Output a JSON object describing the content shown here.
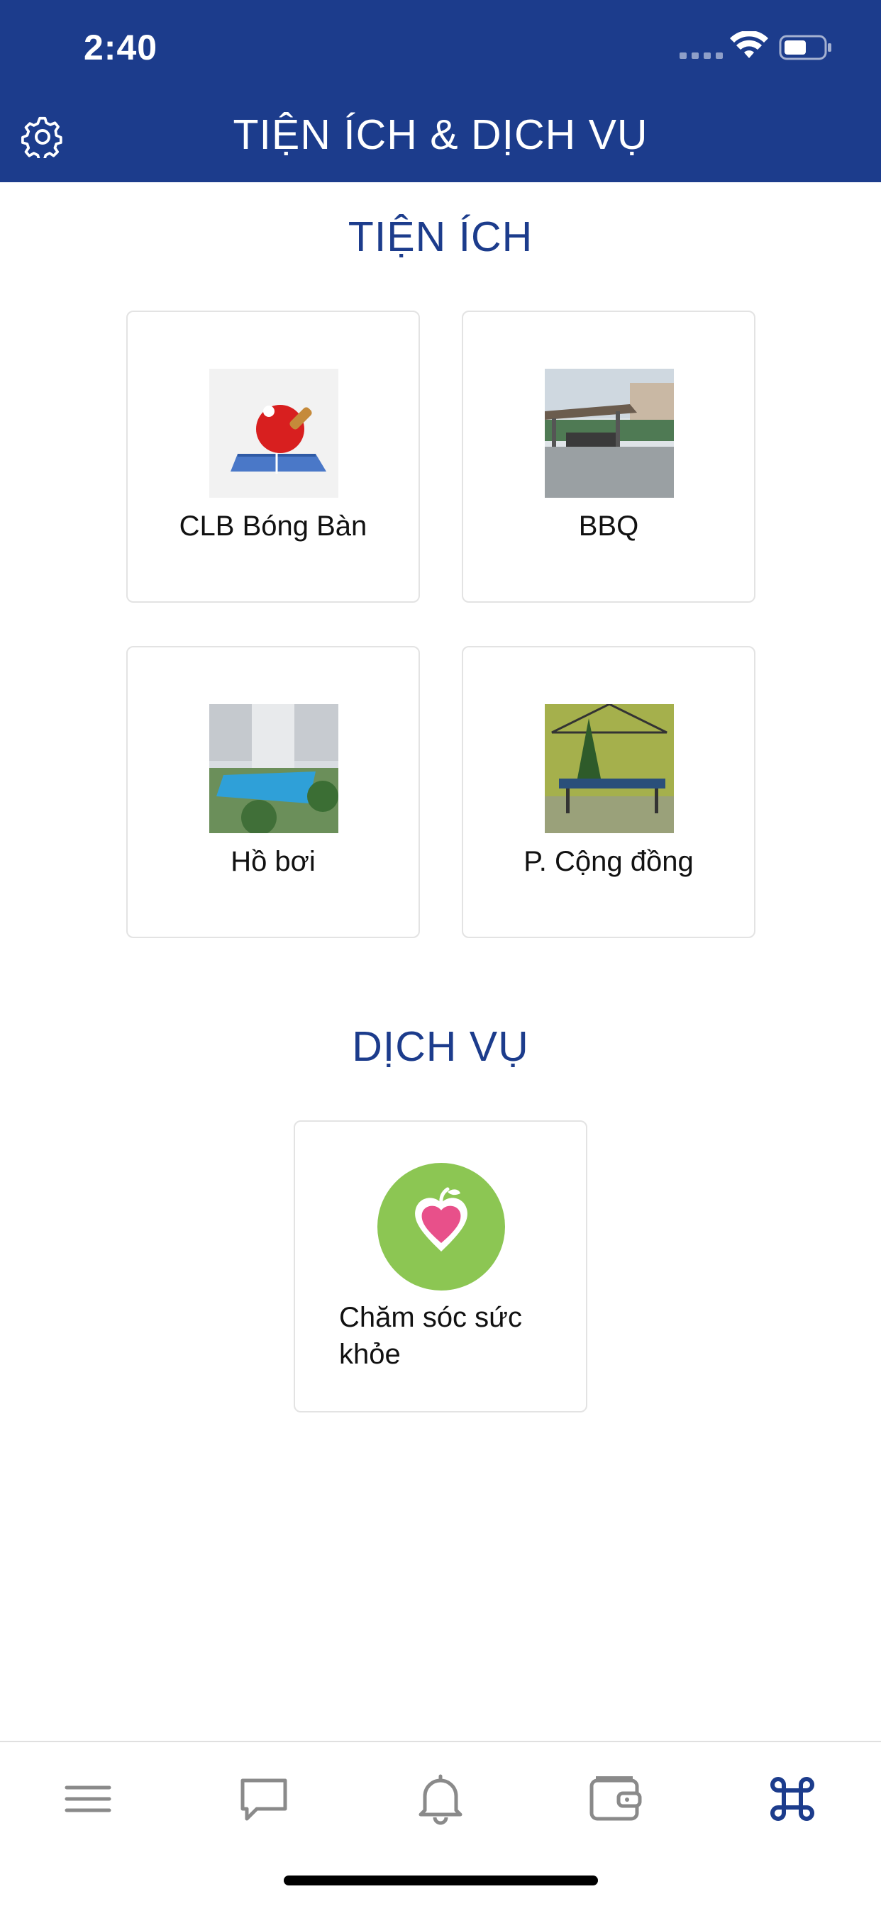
{
  "status_bar": {
    "time": "2:40"
  },
  "header": {
    "title": "TIỆN ÍCH & DỊCH VỤ"
  },
  "sections": {
    "amenities": {
      "title": "TIỆN ÍCH",
      "items": [
        {
          "label": "CLB Bóng Bàn",
          "image": "table-tennis-paddle"
        },
        {
          "label": "BBQ",
          "image": "bbq-pavilion-photo"
        },
        {
          "label": "Hồ bơi",
          "image": "swimming-pool-photo"
        },
        {
          "label": "P. Cộng đồng",
          "image": "community-room-photo"
        }
      ]
    },
    "services": {
      "title": "DỊCH VỤ",
      "items": [
        {
          "label": "Chăm sóc sức khỏe",
          "image": "apple-heart-icon"
        }
      ]
    }
  },
  "tabbar": {
    "items": [
      {
        "icon": "menu-icon",
        "active": false
      },
      {
        "icon": "chat-icon",
        "active": false
      },
      {
        "icon": "bell-icon",
        "active": false
      },
      {
        "icon": "wallet-icon",
        "active": false
      },
      {
        "icon": "command-icon",
        "active": true
      }
    ]
  },
  "colors": {
    "brand": "#1c3c8c",
    "tab_inactive": "#8a8a8a",
    "health_green": "#8cc653",
    "health_pink": "#e8508a"
  }
}
